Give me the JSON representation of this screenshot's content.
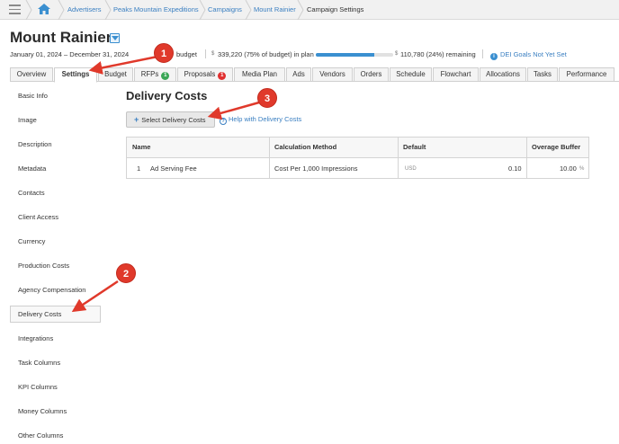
{
  "breadcrumb": {
    "home_icon": "home-icon",
    "items": [
      "Advertisers",
      "Peaks Mountain Expeditions",
      "Campaigns",
      "Mount Rainier",
      "Campaign Settings"
    ]
  },
  "header": {
    "title": "Mount Rainier",
    "dates": "January 01, 2024 – December 31, 2024",
    "budget_label": "budget",
    "in_plan_currency": "$",
    "in_plan_text": "339,220 (75% of budget) in plan",
    "remaining_currency": "$",
    "remaining_text": "110,780 (24%) remaining",
    "plan_fraction": 0.75,
    "dei_text": "DEI Goals Not Yet Set"
  },
  "tabs": [
    {
      "label": "Overview"
    },
    {
      "label": "Settings",
      "active": true
    },
    {
      "label": "Budget"
    },
    {
      "label": "RFPs",
      "badge": "1"
    },
    {
      "label": "Proposals",
      "badge": "1"
    },
    {
      "label": "Media Plan"
    },
    {
      "label": "Ads"
    },
    {
      "label": "Vendors"
    },
    {
      "label": "Orders"
    },
    {
      "label": "Schedule"
    },
    {
      "label": "Flowchart"
    },
    {
      "label": "Allocations"
    },
    {
      "label": "Tasks"
    },
    {
      "label": "Performance"
    }
  ],
  "sidebar": {
    "items": [
      "Basic Info",
      "Image",
      "Description",
      "Metadata",
      "Contacts",
      "Client Access",
      "Currency",
      "Production Costs",
      "Agency Compensation",
      "Delivery Costs",
      "Integrations",
      "Task Columns",
      "KPI Columns",
      "Money Columns",
      "Other Columns"
    ],
    "active": "Delivery Costs"
  },
  "main": {
    "heading": "Delivery Costs",
    "select_button": "Select Delivery Costs",
    "help_link": "Help with Delivery Costs",
    "table": {
      "columns": [
        "Name",
        "Calculation Method",
        "Default",
        "Overage Buffer"
      ],
      "rows": [
        {
          "index": "1",
          "name": "Ad Serving Fee",
          "method": "Cost Per 1,000 Impressions",
          "currency": "USD",
          "default": "0.10",
          "buffer": "10.00",
          "unit": "%"
        }
      ]
    }
  },
  "annotations": [
    "1",
    "2",
    "3"
  ],
  "colors": {
    "link": "#3a7fc1",
    "accent": "#3a8fd0",
    "badge_green": "#3aa655",
    "badge_red": "#e02f2f",
    "annotation": "#e0392b"
  }
}
